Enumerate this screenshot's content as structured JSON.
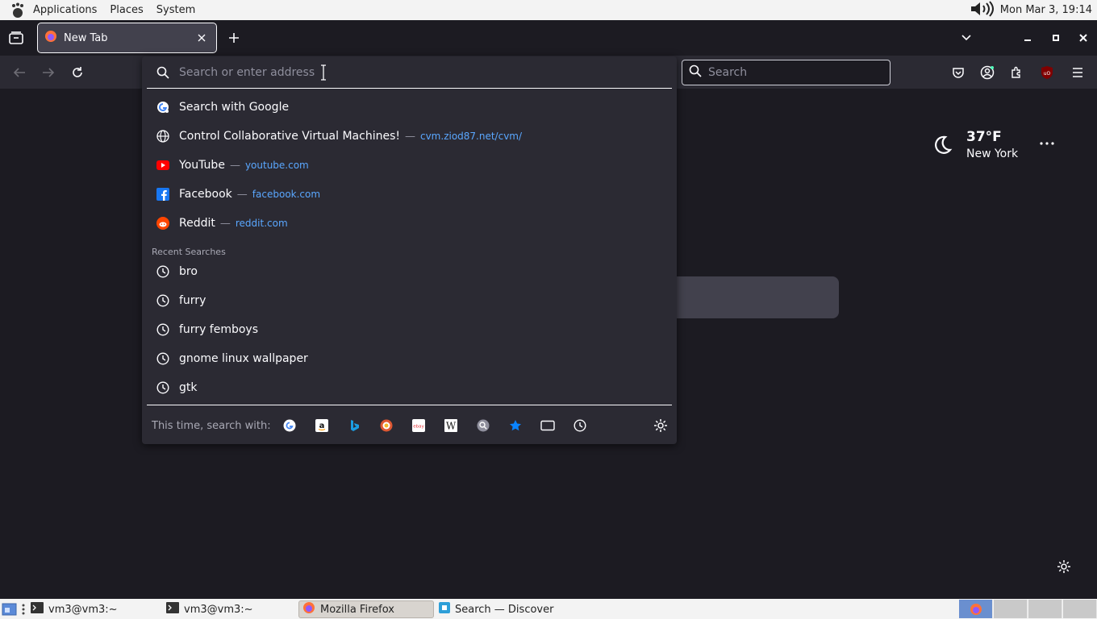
{
  "top_panel": {
    "applications": "Applications",
    "places": "Places",
    "system": "System",
    "clock": "Mon Mar  3, 19:14"
  },
  "tabs": {
    "active_title": "New Tab"
  },
  "toolbar": {
    "search_placeholder": "Search"
  },
  "urlbar": {
    "placeholder": "Search or enter address",
    "results": [
      {
        "icon": "google-icon",
        "title": "Search with Google",
        "url": ""
      },
      {
        "icon": "globe-icon",
        "title": "Control Collaborative Virtual Machines!",
        "url": "cvm.ziod87.net/cvm/"
      },
      {
        "icon": "youtube-icon",
        "title": "YouTube",
        "url": "youtube.com"
      },
      {
        "icon": "facebook-icon",
        "title": "Facebook",
        "url": "facebook.com"
      },
      {
        "icon": "reddit-icon",
        "title": "Reddit",
        "url": "reddit.com"
      }
    ],
    "recent_header": "Recent Searches",
    "recent": [
      "bro",
      "furry",
      "furry femboys",
      "gnome linux wallpaper",
      "gtk"
    ],
    "separator": "—",
    "oneoff_label": "This time, search with:"
  },
  "weather": {
    "temp": "37°F",
    "city": "New York"
  },
  "taskbar": {
    "items": [
      "vm3@vm3:~",
      "vm3@vm3:~",
      "Mozilla Firefox",
      "Search — Discover"
    ]
  },
  "colors": {
    "background": "#1c1b22",
    "toolbar": "#2b2a33",
    "panel": "#f3f3f3",
    "link": "#5aa7ff"
  }
}
